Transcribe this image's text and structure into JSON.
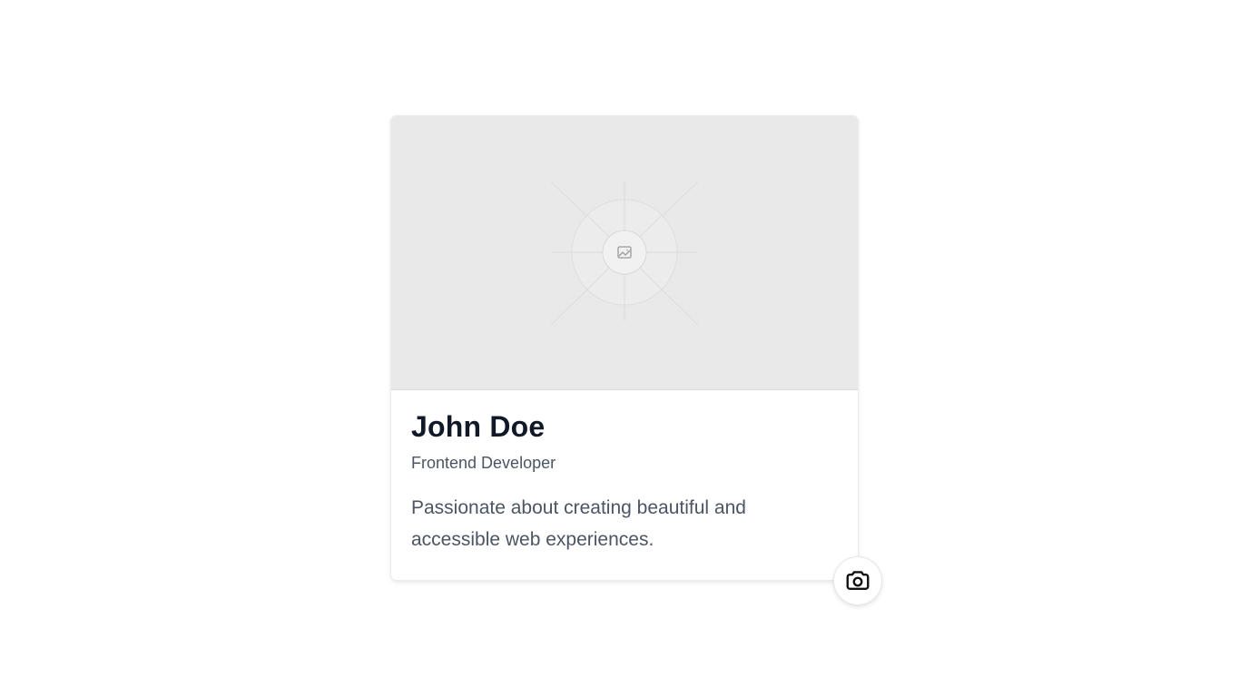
{
  "profile_card": {
    "image": {
      "placeholder_icon": "image-placeholder-icon"
    },
    "name": "John Doe",
    "role": "Frontend Developer",
    "bio": "Passionate about creating beautiful and accessible web experiences."
  },
  "camera_button": {
    "icon": "camera-icon"
  },
  "colors": {
    "background": "#ffffff",
    "image_placeholder_bg": "#e9e9e9",
    "name_text": "#111827",
    "secondary_text": "#4b5563"
  }
}
